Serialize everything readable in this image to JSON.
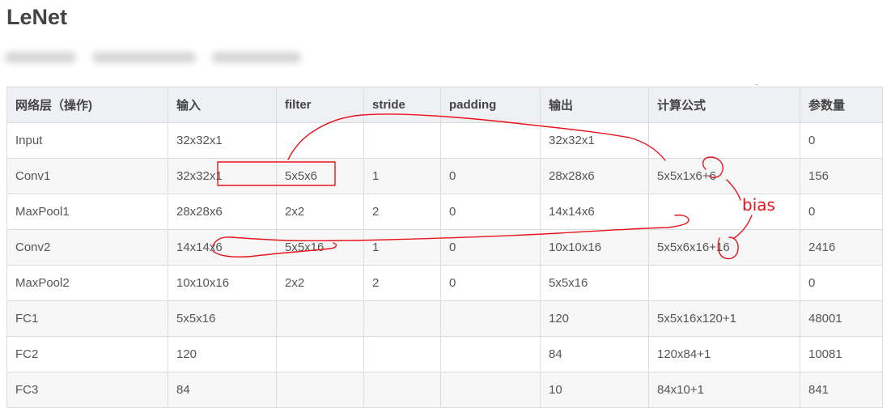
{
  "page": {
    "title": "LeNet"
  },
  "table": {
    "headers": [
      "网络层（操作)",
      "输入",
      "filter",
      "stride",
      "padding",
      "输出",
      "计算公式",
      "参数量"
    ],
    "rows": [
      [
        "Input",
        "32x32x1",
        "",
        "",
        "",
        "32x32x1",
        "",
        "0"
      ],
      [
        "Conv1",
        "32x32x1",
        "5x5x6",
        "1",
        "0",
        "28x28x6",
        "5x5x1x6+6",
        "156"
      ],
      [
        "MaxPool1",
        "28x28x6",
        "2x2",
        "2",
        "0",
        "14x14x6",
        "",
        "0"
      ],
      [
        "Conv2",
        "14x14x6",
        "5x5x16",
        "1",
        "0",
        "10x10x16",
        "5x5x6x16+16",
        "2416"
      ],
      [
        "MaxPool2",
        "10x10x16",
        "2x2",
        "2",
        "0",
        "5x5x16",
        "",
        "0"
      ],
      [
        "FC1",
        "5x5x16",
        "",
        "",
        "",
        "120",
        "5x5x16x120+1",
        "48001"
      ],
      [
        "FC2",
        "120",
        "",
        "",
        "",
        "84",
        "120x84+1",
        "10081"
      ],
      [
        "FC3",
        "84",
        "",
        "",
        "",
        "10",
        "84x10+1",
        "841"
      ]
    ]
  },
  "annotations": {
    "bias_label": "bias",
    "ink_color": "#e8141c"
  }
}
